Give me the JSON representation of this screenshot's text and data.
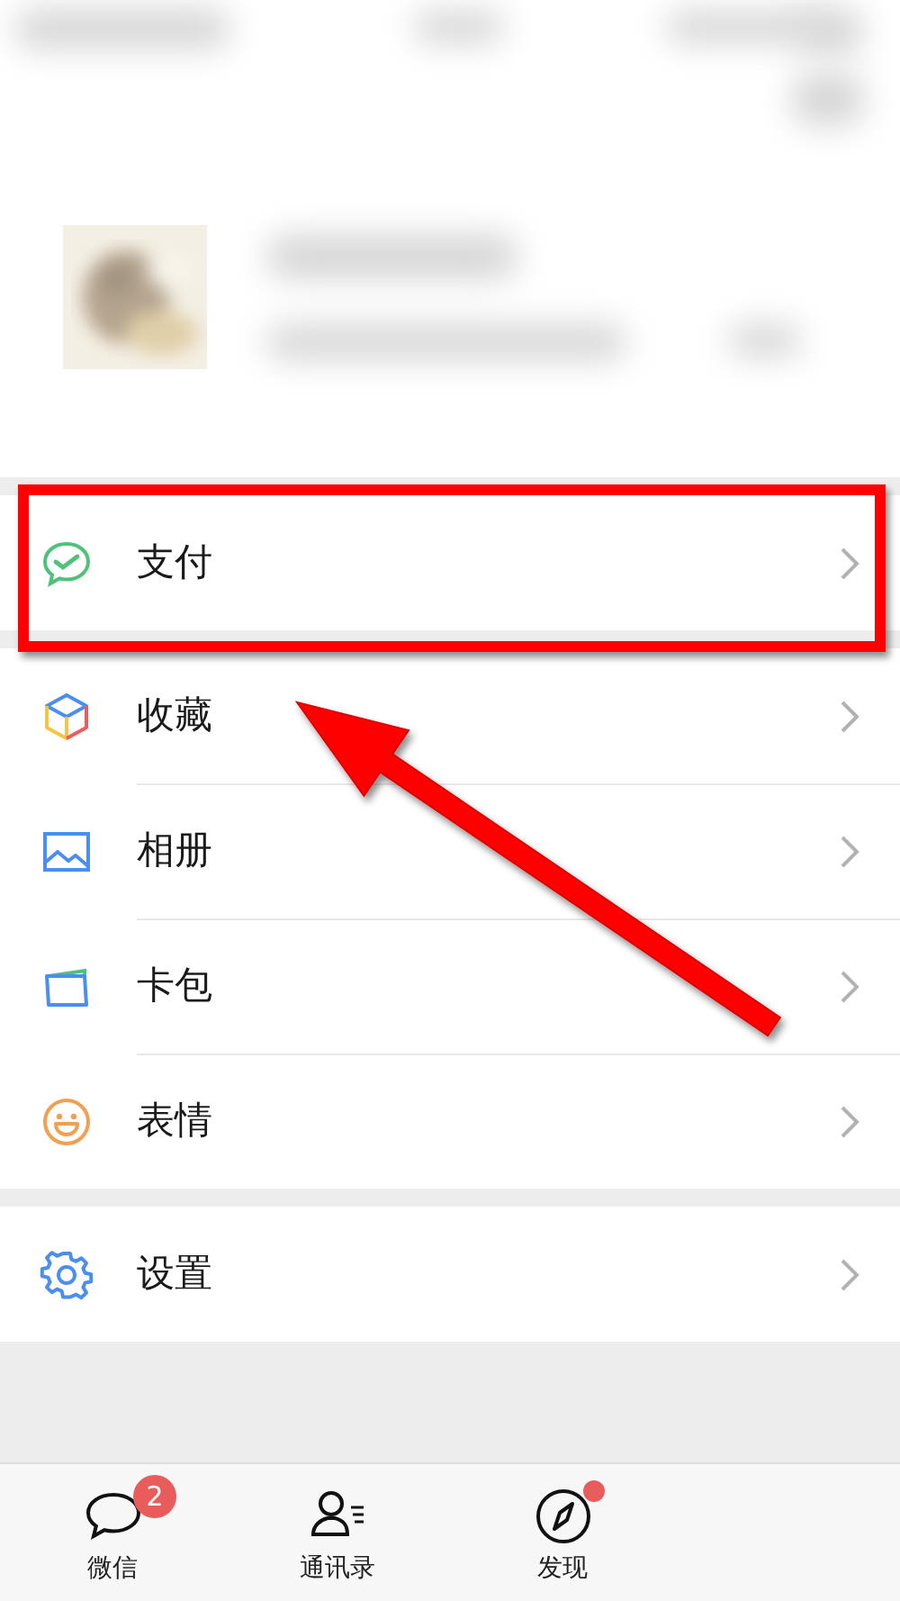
{
  "profile": {
    "kind": "blurred"
  },
  "groups": [
    {
      "items": [
        {
          "kind": "pay",
          "label": "支付",
          "highlighted": true
        }
      ]
    },
    {
      "items": [
        {
          "kind": "cube",
          "label": "收藏",
          "highlighted": false
        },
        {
          "label": "相册",
          "highlighted": false
        },
        {
          "kind": "card",
          "label": "卡包",
          "highlighted": false
        },
        {
          "kind": "smile",
          "label": "表情",
          "highlighted": false
        }
      ]
    },
    {
      "items": [
        {
          "kind": "gear",
          "label": "设置",
          "highlighted": false
        }
      ]
    }
  ],
  "tabs": [
    {
      "kind": "chat",
      "label": "微信",
      "selected": false,
      "badge": "2",
      "dot": false
    },
    {
      "kind": "contacts",
      "label": "通讯录",
      "selected": false,
      "dot": false
    },
    {
      "kind": "compass",
      "label": "发现",
      "selected": false,
      "dot": true
    }
  ]
}
